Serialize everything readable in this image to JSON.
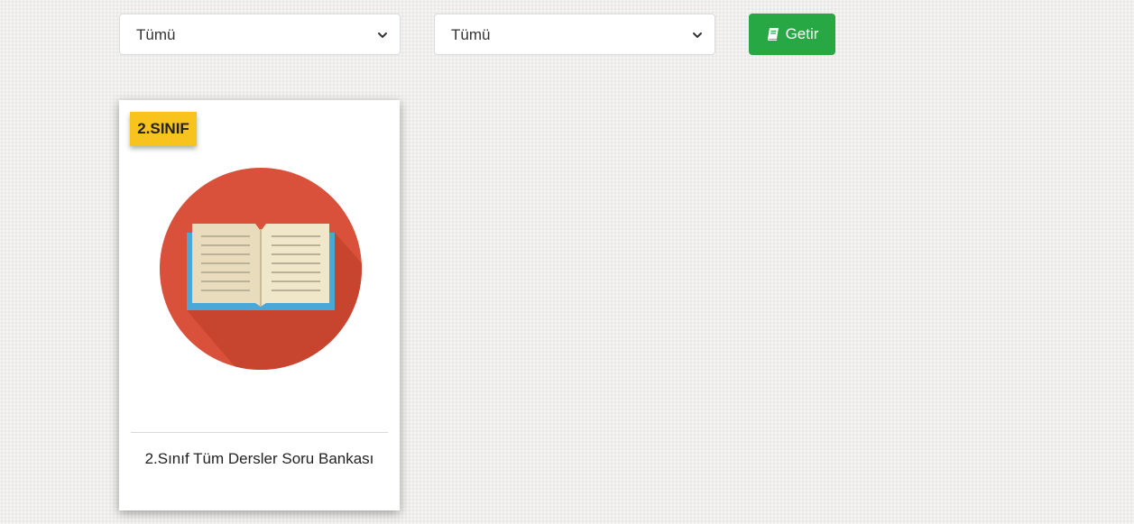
{
  "filters": {
    "first_select_value": "Tümü",
    "second_select_value": "Tümü",
    "button_label": "Getir"
  },
  "card": {
    "badge": "2.SINIF",
    "title": "2.Sınıf Tüm Dersler Soru Bankası",
    "image_icon": "open-book-icon"
  },
  "colors": {
    "button_green": "#28a745",
    "badge_yellow": "#f8c31c",
    "circle_red": "#d9513a",
    "book_blue": "#4aa8d8",
    "page_cream": "#f0e6ca"
  }
}
